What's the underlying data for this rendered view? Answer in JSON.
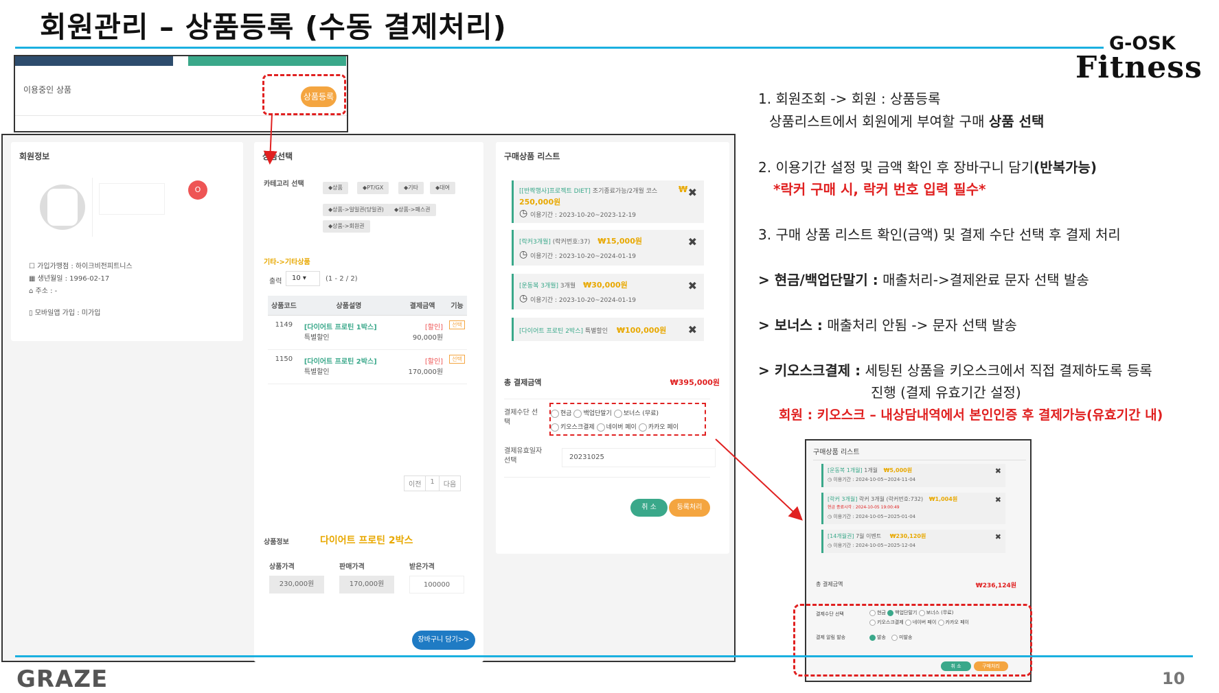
{
  "title": "회원관리 – 상품등록 (수동 결제처리)",
  "brand": {
    "line1": "G-OSK",
    "line2": "Fitness"
  },
  "footer": {
    "logo": "GRAZE",
    "page": "10"
  },
  "top_shot": {
    "label": "이용중인 상품",
    "button": "상품등록"
  },
  "member": {
    "title": "회원정보",
    "badge": "O",
    "gym": "가입가맹점 : 하이크비전피트니스",
    "birth": "생년월일 : 1996-02-17",
    "addr": "주소 : -",
    "app": "모바일앱 가입 : 미가입"
  },
  "product_select": {
    "title": "상품선택",
    "category_label": "카테고리 선택",
    "tags": [
      "상품",
      "PT/GX",
      "기타",
      "대여",
      "상품->일일권(당일권)",
      "상품->패스권",
      "상품->회원권"
    ],
    "breadcrumb": "기타->기타상품",
    "rows_label": "출력",
    "rows_value": "10",
    "page_info": "(1 - 2 / 2)",
    "headers": [
      "상품코드",
      "상품설명",
      "결제금액",
      "기능"
    ],
    "rows": [
      {
        "code": "1149",
        "name": "[다이어트 프로틴 1박스]",
        "sub": "특별할인",
        "tag": "[할인]",
        "price": "90,000원",
        "btn": "선택"
      },
      {
        "code": "1150",
        "name": "[다이어트 프로틴 2박스]",
        "sub": "특별할인",
        "tag": "[할인]",
        "price": "170,000원",
        "btn": "선택"
      }
    ],
    "pager": {
      "prev": "이전",
      "cur": "1",
      "next": "다음"
    },
    "info_label": "상품정보",
    "info_name": "다이어트 프로틴 2박스",
    "price_labels": [
      "상품가격",
      "판매가격",
      "받은가격"
    ],
    "price_values": [
      "230,000원",
      "170,000원",
      "100000"
    ],
    "cart_button": "장바구니 담기>>"
  },
  "cart": {
    "title": "구매상품 리스트",
    "items": [
      {
        "name": "[[반짝행사]프로젝트 DIET]",
        "desc": "조기종료가능/2개월 코스",
        "price": "250,000원",
        "cur": "₩",
        "period": "이용기간 : 2023-10-20~2023-12-19"
      },
      {
        "name": "[락커3개월]",
        "desc": "(락커번호:37)",
        "price": "₩15,000원",
        "period": "이용기간 : 2023-10-20~2024-01-19"
      },
      {
        "name": "[운동복 3개월]",
        "desc": "3개월",
        "price": "₩30,000원",
        "period": "이용기간 : 2023-10-20~2024-01-19"
      },
      {
        "name": "[다이어트 프로틴 2박스]",
        "desc": "특별할인",
        "price": "₩100,000원",
        "period": ""
      }
    ],
    "total_label": "총 결제금액",
    "total": "₩395,000원",
    "pay_label": "결제수단 선택",
    "pay_options": [
      "현금",
      "백업단말기",
      "보너스 (무료)",
      "키오스크결제",
      "네이버 페이",
      "카카오 페이"
    ],
    "date_label": "결제유효일자 선택",
    "date_value": "20231025",
    "cancel": "취 소",
    "submit": "등록처리"
  },
  "steps": {
    "s1a": "1. 회원조회 -> 회원 : 상품등록",
    "s1b_pre": "상품리스트에서 회원에게 부여할 구매 ",
    "s1b_bold": "상품 선택",
    "s2_pre": "2. 이용기간 설정 및 금액 확인 후 장바구니 담기",
    "s2_bold": "(반복가능)",
    "s2_red": "*락커 구매 시, 락커 번호 입력 필수*",
    "s3": "3. 구매 상품 리스트 확인(금액) 및 결제 수단 선택 후 결제 처리",
    "c1_bold": "> 현금/백업단말기 :",
    "c1": " 매출처리->결제완료 문자 선택 발송",
    "c2_bold": "> 보너스 :",
    "c2": " 매출처리 안됨 -> 문자 선택 발송",
    "c3_bold": "> 키오스크결제 :",
    "c3": " 세팅된 상품을 키오스크에서 직접 결제하도록 등록",
    "c3b": "진행 (결제 유효기간 설정)",
    "c3_red": "회원 : 키오스크 – 내상담내역에서 본인인증 후 결제가능(유효기간 내)"
  },
  "side_shot": {
    "title": "구매상품 리스트",
    "items": [
      {
        "name": "[운동복 1개월]",
        "desc": "1개월",
        "price": "₩5,000원",
        "extra": "",
        "period": "이용기간 : 2024-10-05~2024-11-04"
      },
      {
        "name": "[락커 3개월]",
        "desc": "락커 3개월 (락커번호:732)",
        "price": "₩1,004원",
        "extra": "현금 종료시각 : 2024-10-05 19:00:49",
        "period": "이용기간 : 2024-10-05~2025-01-04"
      },
      {
        "name": "[14개월권]",
        "desc": "7월 이벤트",
        "price": "₩230,120원",
        "extra": "",
        "period": "이용기간 : 2024-10-05~2025-12-04"
      }
    ],
    "total_label": "총 결제금액",
    "total": "₩236,124원",
    "pay_label": "결제수단 선택",
    "pay_options": [
      "현금",
      "백업단말기",
      "보너스 (무료)",
      "키오스크결제",
      "네이버 페이",
      "카카오 페이"
    ],
    "notify_label": "결제 알림 발송",
    "notify_options": [
      "발송",
      "미발송"
    ],
    "cancel": "취 소",
    "submit": "구매처리"
  }
}
